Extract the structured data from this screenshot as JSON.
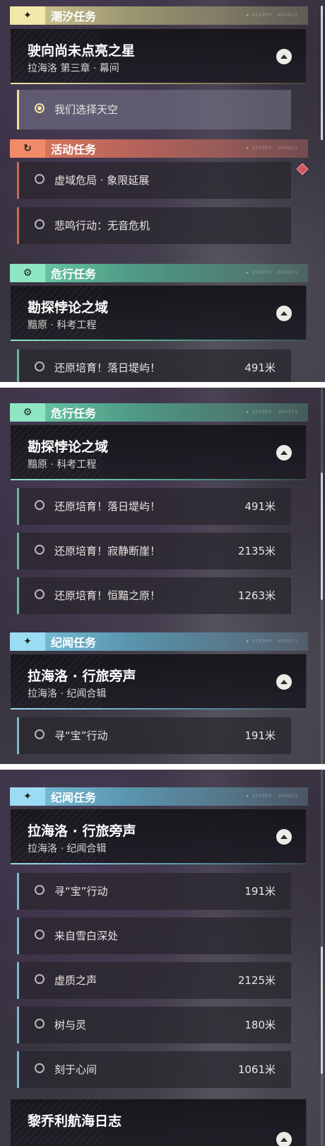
{
  "panel1": {
    "chaoxi": {
      "label": "潮汐任务",
      "icon": "star-icon"
    },
    "chaoxi_quest": {
      "title": "驶向尚未点亮之星",
      "subtitle": "拉海洛 第三章 · 幕间"
    },
    "chaoxi_item": {
      "name": "我们选择天空"
    },
    "huodong": {
      "label": "活动任务",
      "icon": "refresh-icon"
    },
    "huodong_items": [
      {
        "name": "虚域危局 · 象限延展"
      },
      {
        "name": "悲鸣行动：无音危机"
      }
    ],
    "weixing": {
      "label": "危行任务",
      "icon": "danger-badge-icon"
    },
    "weixing_quest": {
      "title": "勘探悖论之域",
      "subtitle": "黯原 · 科考工程"
    },
    "weixing_partial": {
      "name": "还原培育！落日堤屿！",
      "distance": "491米"
    }
  },
  "panel2": {
    "weixing": {
      "label": "危行任务"
    },
    "weixing_quest": {
      "title": "勘探悖论之域",
      "subtitle": "黯原 · 科考工程"
    },
    "weixing_items": [
      {
        "name": "还原培育！落日堤屿！",
        "distance": "491米"
      },
      {
        "name": "还原培育！寂静断崖！",
        "distance": "2135米"
      },
      {
        "name": "还原培育！恒黯之原！",
        "distance": "1263米"
      }
    ],
    "jiwen": {
      "label": "纪闻任务"
    },
    "jiwen_quest": {
      "title": "拉海洛 · 行旅旁声",
      "subtitle": "拉海洛 · 纪闻合辑"
    },
    "jiwen_item": {
      "name": "寻“宝”行动",
      "distance": "191米"
    }
  },
  "panel3": {
    "jiwen": {
      "label": "纪闻任务"
    },
    "jiwen_quest": {
      "title": "拉海洛 · 行旅旁声",
      "subtitle": "拉海洛 · 纪闻合辑"
    },
    "jiwen_items": [
      {
        "name": "寻“宝”行动",
        "distance": "191米"
      },
      {
        "name": "来自雪白深处",
        "distance": ""
      },
      {
        "name": "虚质之声",
        "distance": "2125米"
      },
      {
        "name": "树与灵",
        "distance": "180米"
      },
      {
        "name": "刻于心间",
        "distance": "1061米"
      }
    ],
    "next_quest": {
      "title": "黎乔利航海日志"
    }
  },
  "category_deco": "◆ SEXOPS ·KOVELS",
  "colors": {
    "chaoxi": "#f1e7a8",
    "huodong": "#f08a68",
    "weixing": "#8ee6c4",
    "jiwen": "#9bdcf3",
    "selected_ring": "#efe3a0",
    "alert": "#d4565f"
  }
}
